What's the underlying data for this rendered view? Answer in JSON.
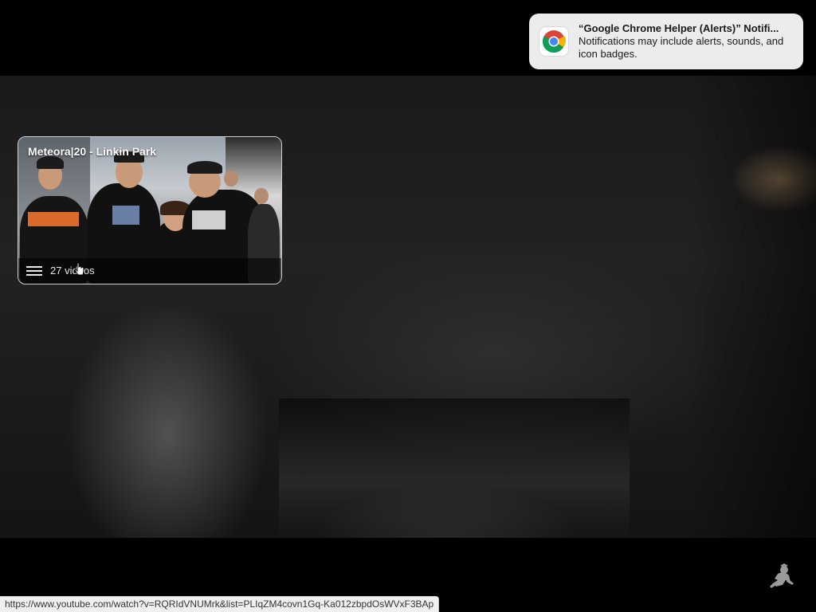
{
  "notification": {
    "title": "“Google Chrome Helper (Alerts)” Notifi...",
    "body": "Notifications may include alerts, sounds, and icon badges.",
    "icon": "chrome-icon"
  },
  "playlist_card": {
    "title": "Meteora|20 - Linkin Park",
    "video_count": "27 videos",
    "icon": "playlist-icon"
  },
  "status_bar": {
    "url": "https://www.youtube.com/watch?v=RQRIdVNUMrk&list=PLIqZM4covn1Gq-Ka012zbpdOsWVxF3BAp"
  },
  "corner_logo": {
    "icon": "mascot-icon"
  },
  "colors": {
    "background": "#000000",
    "notification_bg": "#ececec",
    "status_bar_bg": "#f0f0f0"
  }
}
